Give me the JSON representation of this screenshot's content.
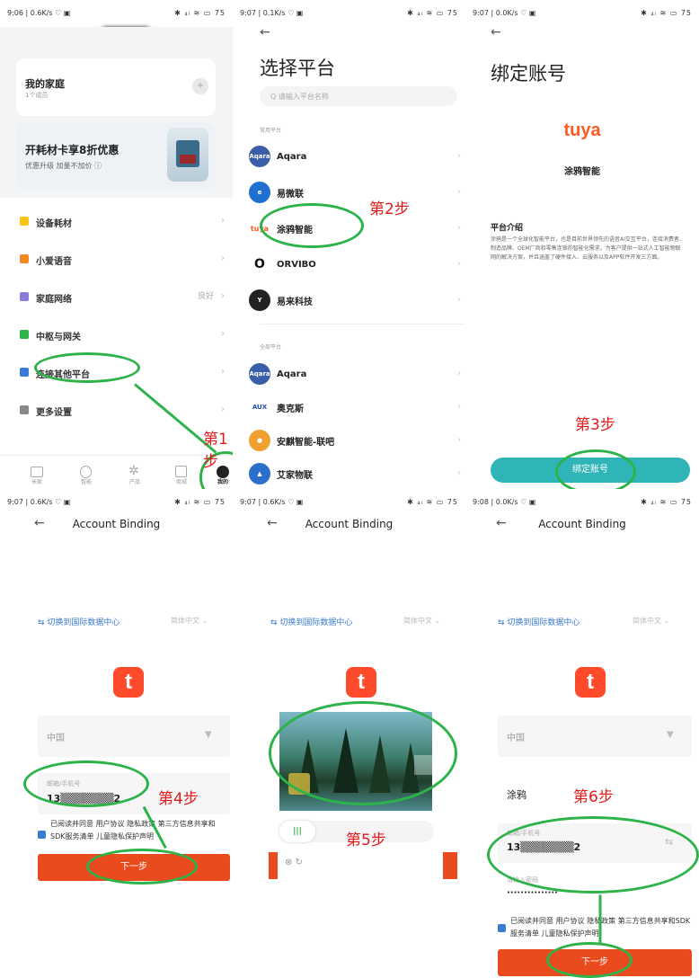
{
  "panel1": {
    "status_left": "9:06 | 0.6K/s ♡ ▣",
    "status_right": "✱ ₄ₗ ≋ ▭ 75",
    "family_title": "我的家庭",
    "family_sub": "1个成员",
    "promo_title": "开耗材卡享8折优惠",
    "promo_sub": "优惠升级 加量不加价 ⓘ",
    "menu": [
      "设备耗材",
      "小爱语音",
      "家庭网络",
      "中枢与网关",
      "连接其他平台",
      "更多设置"
    ],
    "network_status": "良好",
    "tabs": [
      "米家",
      "智能",
      "产品",
      "商城",
      "我的"
    ],
    "step_label": "第1步"
  },
  "panel2": {
    "status_left": "9:07 | 0.1K/s ♡ ▣",
    "status_right": "✱ ₄ₗ ≋ ▭ 75",
    "title": "选择平台",
    "search_placeholder": "Q 请输入平台名称",
    "section_common": "常用平台",
    "section_all": "全部平台",
    "common": [
      {
        "name": "Aqara",
        "logo": "Aqara"
      },
      {
        "name": "易微联",
        "logo": "e"
      },
      {
        "name": "涂鸦智能",
        "logo": "tuya"
      },
      {
        "name": "ORVIBO",
        "logo": "O"
      },
      {
        "name": "易来科技",
        "logo": "Y"
      }
    ],
    "all": [
      {
        "name": "Aqara",
        "logo": "Aqara"
      },
      {
        "name": "奥克斯",
        "logo": "AUX"
      },
      {
        "name": "安麒智能-联吧",
        "logo": "●"
      },
      {
        "name": "艾家物联",
        "logo": "▲"
      }
    ],
    "step_label": "第2步"
  },
  "panel3": {
    "status_left": "9:07 | 0.0K/s ♡ ▣",
    "status_right": "✱ ₄ₗ ≋ ▭ 75",
    "title": "绑定账号",
    "brand_logo": "tuya",
    "brand_name": "涂鸦智能",
    "intro_title": "平台介绍",
    "intro_text": "涂鸦是一个全球化智能平台，也是目前世界领先的语音AI交互平台，连接消费者、制造品牌、OEM厂商和零售连锁的智能化需求，为客户提供一站式人工智能物联网的解决方案，并且涵盖了硬件接入、云服务以及APP软件开发三方面。",
    "bind_button": "绑定账号",
    "step_label": "第3步"
  },
  "panel4": {
    "status_left": "9:07 | 0.6K/s ♡ ▣",
    "status_right": "✱ ₄ₗ ≋ ▭ 75",
    "title": "Account Binding",
    "switch_center": "⇆ 切换到国际数据中心",
    "language": "简体中文 ⌄",
    "country": "中国",
    "account_label": "邮箱/手机号",
    "account_value": "13▒▒▒▒▒▒▒2",
    "agree_text": "已阅读并同意 用户协议 隐私政策 第三方信息共享和SDK服务清单 儿童隐私保护声明",
    "next_button": "下一步",
    "step_label": "第4步"
  },
  "panel5": {
    "status_left": "9:07 | 0.6K/s ♡ ▣",
    "status_right": "✱ ₄ₗ ≋ ▭ 75",
    "title": "Account Binding",
    "switch_center": "⇆ 切换到国际数据中心",
    "language": "简体中文 ⌄",
    "slider_handle": "|||",
    "step_label": "第5步"
  },
  "panel6": {
    "status_left": "9:08 | 0.0K/s ♡ ▣",
    "status_right": "✱ ₄ₗ ≋ ▭ 75",
    "title": "Account Binding",
    "switch_center": "⇆ 切换到国际数据中心",
    "language": "简体中文 ⌄",
    "country": "中国",
    "brand": "涂鸦",
    "account_label": "邮箱/手机号",
    "account_value": "13▒▒▒▒▒▒▒2",
    "password_placeholder": "请输入密码",
    "password_value": "···············",
    "agree_text": "已阅读并同意 用户协议 隐私政策 第三方信息共享和SDK服务清单 儿童隐私保护声明",
    "next_button": "下一步",
    "step_label": "第6步"
  }
}
